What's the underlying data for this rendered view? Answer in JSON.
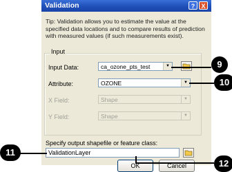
{
  "window": {
    "title": "Validation",
    "help_label": "?",
    "close_label": "X",
    "tip": "Tip: Validation allows you to estimate the value at the specified data locations and to compare results of prediction with measured values (if such measurements exist)."
  },
  "input_group": {
    "label": "Input",
    "input_data": {
      "label": "Input Data:",
      "value": "ca_ozone_pts_test"
    },
    "attribute": {
      "label": "Attribute:",
      "value": "OZONE"
    },
    "x_field": {
      "label": "X Field:",
      "value": "Shape"
    },
    "y_field": {
      "label": "Y Field:",
      "value": "Shape"
    }
  },
  "output": {
    "label": "Specify output shapefile or feature class:",
    "value": "ValidationLayer"
  },
  "buttons": {
    "ok": "OK",
    "cancel": "Cancel"
  },
  "callouts": {
    "c9": "9",
    "c10": "10",
    "c11": "11",
    "c12": "12"
  }
}
